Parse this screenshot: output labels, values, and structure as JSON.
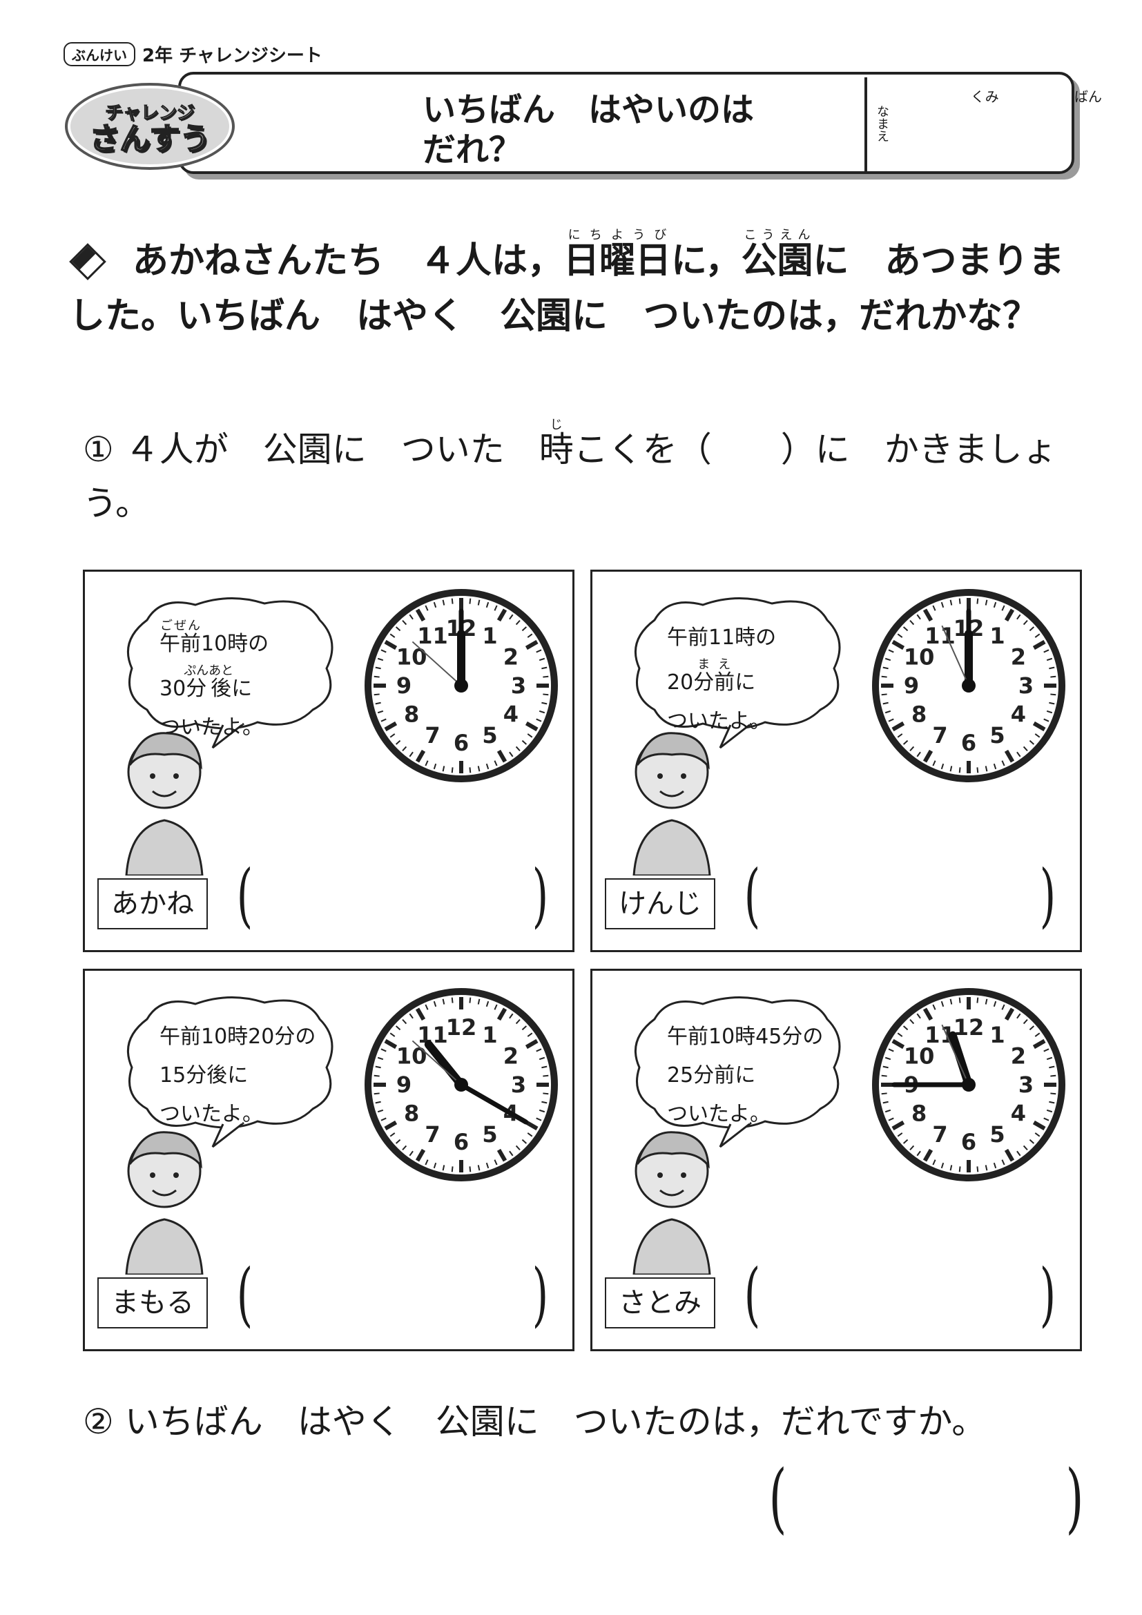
{
  "top_label": {
    "badge": "ぶんけい",
    "text": "2年 チャレンジシート"
  },
  "header": {
    "badge_top": "チャレンジ",
    "badge_bottom": "さんすう",
    "title": "いちばん　はやいのは\nだれ？",
    "name_label": "なまえ",
    "kumi": "くみ",
    "ban": "ばん"
  },
  "problem": {
    "part1": "あかねさんたち　４人は，",
    "nichiyoubi": "日曜日",
    "nichiyoubi_ruby": "にちようび",
    "part2": "に，",
    "kouen": "公園",
    "kouen_ruby": "こうえん",
    "part3": "に　あつまりました。いちばん　はやく　公園に　ついたのは，だれかな？"
  },
  "q1": {
    "num": "①",
    "part1": "４人が　公園に　ついた　",
    "ji": "時",
    "ji_ruby": "じ",
    "part2": "こくを（　　）に　かきましょう。"
  },
  "panels": [
    {
      "name": "あかね",
      "line1a": "",
      "gozen": "午前",
      "gozen_ruby": "ごぜん",
      "line1b": "10時の",
      "line2a": "30",
      "fun": "分後",
      "fun_ruby": "ぷんあと",
      "line2b": "に",
      "line3": "ついたよ。",
      "clock": {
        "hour": 12,
        "minute": 0,
        "second_hand_minute": 52
      }
    },
    {
      "name": "けんじ",
      "line1a": "",
      "gozen": "午前",
      "gozen_ruby": "",
      "line1b": "11時の",
      "line2a": "20",
      "fun": "分前",
      "fun_ruby": "まえ",
      "line2b": "に",
      "line3": "ついたよ。",
      "clock": {
        "hour": 12,
        "minute": 0,
        "second_hand_minute": 56
      }
    },
    {
      "name": "まもる",
      "line1a": "",
      "gozen": "午前",
      "gozen_ruby": "",
      "line1b": "10時20分の",
      "line2a": "15",
      "fun": "分後",
      "fun_ruby": "",
      "line2b": "に",
      "line3": "ついたよ。",
      "clock": {
        "hour": 10.7,
        "minute": 20,
        "second_hand_minute": 52
      }
    },
    {
      "name": "さとみ",
      "line1a": "",
      "gozen": "午前",
      "gozen_ruby": "",
      "line1b": "10時45分の",
      "line2a": "25",
      "fun": "分前",
      "fun_ruby": "",
      "line2b": "に",
      "line3": "ついたよ。",
      "clock": {
        "hour": 11.4,
        "minute": 45,
        "second_hand_minute": 56
      }
    }
  ],
  "q2": {
    "num": "②",
    "text": "いちばん　はやく　公園に　ついたのは，だれですか。"
  },
  "paren": {
    "open": "(",
    "close": ")"
  }
}
